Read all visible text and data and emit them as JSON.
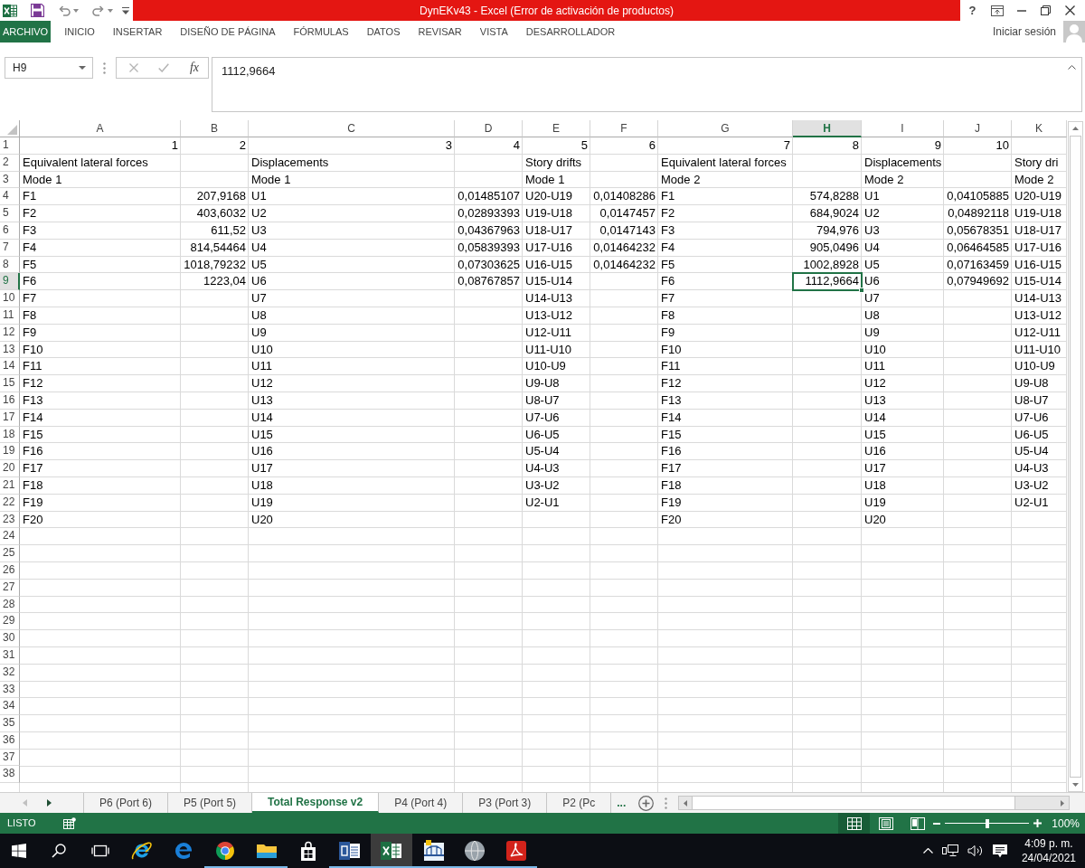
{
  "title_bar": {
    "title": "DynEKv43 - Excel (Error de activación de productos)",
    "help": "?"
  },
  "ribbon_tabs": [
    {
      "label": "ARCHIVO",
      "kind": "file",
      "selected": false
    },
    {
      "label": "INICIO",
      "kind": "tab",
      "selected": false
    },
    {
      "label": "INSERTAR",
      "kind": "tab",
      "selected": false
    },
    {
      "label": "DISEÑO DE PÁGINA",
      "kind": "tab",
      "selected": false
    },
    {
      "label": "FÓRMULAS",
      "kind": "tab",
      "selected": false
    },
    {
      "label": "DATOS",
      "kind": "tab",
      "selected": false
    },
    {
      "label": "REVISAR",
      "kind": "tab",
      "selected": false
    },
    {
      "label": "VISTA",
      "kind": "tab",
      "selected": false
    },
    {
      "label": "DESARROLLADOR",
      "kind": "tab",
      "selected": false
    }
  ],
  "account": {
    "label": "Iniciar sesión"
  },
  "formula_bar": {
    "name_box": "H9",
    "editing": false,
    "insert_function": "fx",
    "value": "1112,9664"
  },
  "columns": [
    {
      "label": "A",
      "selected": false
    },
    {
      "label": "B",
      "selected": false
    },
    {
      "label": "C",
      "selected": false
    },
    {
      "label": "D",
      "selected": false
    },
    {
      "label": "E",
      "selected": false
    },
    {
      "label": "F",
      "selected": false
    },
    {
      "label": "G",
      "selected": false
    },
    {
      "label": "H",
      "selected": true
    },
    {
      "label": "I",
      "selected": false
    },
    {
      "label": "J",
      "selected": false
    },
    {
      "label": "K",
      "selected": false
    }
  ],
  "rows": [
    {
      "label": "1",
      "selected": false,
      "cells": [
        {
          "kind": "number",
          "text": "1"
        },
        {
          "kind": "number",
          "text": "2"
        },
        {
          "kind": "number",
          "text": "3"
        },
        {
          "kind": "number",
          "text": "4"
        },
        {
          "kind": "number",
          "text": "5"
        },
        {
          "kind": "number",
          "text": "6"
        },
        {
          "kind": "number",
          "text": "7"
        },
        {
          "kind": "number",
          "text": "8"
        },
        {
          "kind": "number",
          "text": "9"
        },
        {
          "kind": "number",
          "text": "10"
        }
      ]
    },
    {
      "label": "2",
      "selected": false,
      "cells": [
        {
          "kind": "text",
          "text": "Equivalent lateral forces"
        },
        {
          "kind": "blank"
        },
        {
          "kind": "text",
          "text": "Displacements"
        },
        {
          "kind": "blank"
        },
        {
          "kind": "text",
          "text": "Story drifts"
        },
        {
          "kind": "blank"
        },
        {
          "kind": "text",
          "text": "Equivalent lateral forces"
        },
        {
          "kind": "blank"
        },
        {
          "kind": "text",
          "text": "Displacements"
        },
        {
          "kind": "blank"
        },
        {
          "kind": "text",
          "text": "Story dri"
        }
      ]
    },
    {
      "label": "3",
      "selected": false,
      "cells": [
        {
          "kind": "text",
          "text": "Mode 1"
        },
        {
          "kind": "blank"
        },
        {
          "kind": "text",
          "text": "Mode 1"
        },
        {
          "kind": "blank"
        },
        {
          "kind": "text",
          "text": "Mode 1"
        },
        {
          "kind": "blank"
        },
        {
          "kind": "text",
          "text": "Mode 2"
        },
        {
          "kind": "blank"
        },
        {
          "kind": "text",
          "text": "Mode 2"
        },
        {
          "kind": "blank"
        },
        {
          "kind": "text",
          "text": "Mode 2"
        }
      ]
    },
    {
      "label": "4",
      "selected": false,
      "cells": [
        {
          "kind": "text",
          "text": "F1"
        },
        {
          "kind": "number",
          "text": "207,9168"
        },
        {
          "kind": "text",
          "text": "U1"
        },
        {
          "kind": "number",
          "text": "0,01485107"
        },
        {
          "kind": "text",
          "text": "U20-U19"
        },
        {
          "kind": "number",
          "text": "0,01408286"
        },
        {
          "kind": "text",
          "text": "F1"
        },
        {
          "kind": "number",
          "text": "574,8288"
        },
        {
          "kind": "text",
          "text": "U1"
        },
        {
          "kind": "number",
          "text": "0,04105885"
        },
        {
          "kind": "text",
          "text": "U20-U19"
        }
      ]
    },
    {
      "label": "5",
      "selected": false,
      "cells": [
        {
          "kind": "text",
          "text": "F2"
        },
        {
          "kind": "number",
          "text": "403,6032"
        },
        {
          "kind": "text",
          "text": "U2"
        },
        {
          "kind": "number",
          "text": "0,02893393"
        },
        {
          "kind": "text",
          "text": "U19-U18"
        },
        {
          "kind": "number",
          "text": "0,0147457"
        },
        {
          "kind": "text",
          "text": "F2"
        },
        {
          "kind": "number",
          "text": "684,9024"
        },
        {
          "kind": "text",
          "text": "U2"
        },
        {
          "kind": "number",
          "text": "0,04892118"
        },
        {
          "kind": "text",
          "text": "U19-U18"
        }
      ]
    },
    {
      "label": "6",
      "selected": false,
      "cells": [
        {
          "kind": "text",
          "text": "F3"
        },
        {
          "kind": "number",
          "text": "611,52"
        },
        {
          "kind": "text",
          "text": "U3"
        },
        {
          "kind": "number",
          "text": "0,04367963"
        },
        {
          "kind": "text",
          "text": "U18-U17"
        },
        {
          "kind": "number",
          "text": "0,0147143"
        },
        {
          "kind": "text",
          "text": "F3"
        },
        {
          "kind": "number",
          "text": "794,976"
        },
        {
          "kind": "text",
          "text": "U3"
        },
        {
          "kind": "number",
          "text": "0,05678351"
        },
        {
          "kind": "text",
          "text": "U18-U17"
        }
      ]
    },
    {
      "label": "7",
      "selected": false,
      "cells": [
        {
          "kind": "text",
          "text": "F4"
        },
        {
          "kind": "number",
          "text": "814,54464"
        },
        {
          "kind": "text",
          "text": "U4"
        },
        {
          "kind": "number",
          "text": "0,05839393"
        },
        {
          "kind": "text",
          "text": "U17-U16"
        },
        {
          "kind": "number",
          "text": "0,01464232"
        },
        {
          "kind": "text",
          "text": "F4"
        },
        {
          "kind": "number",
          "text": "905,0496"
        },
        {
          "kind": "text",
          "text": "U4"
        },
        {
          "kind": "number",
          "text": "0,06464585"
        },
        {
          "kind": "text",
          "text": "U17-U16"
        }
      ]
    },
    {
      "label": "8",
      "selected": false,
      "cells": [
        {
          "kind": "text",
          "text": "F5"
        },
        {
          "kind": "number",
          "text": "1018,79232"
        },
        {
          "kind": "text",
          "text": "U5"
        },
        {
          "kind": "number",
          "text": "0,07303625"
        },
        {
          "kind": "text",
          "text": "U16-U15"
        },
        {
          "kind": "number",
          "text": "0,01464232"
        },
        {
          "kind": "text",
          "text": "F5"
        },
        {
          "kind": "number",
          "text": "1002,8928"
        },
        {
          "kind": "text",
          "text": "U5"
        },
        {
          "kind": "number",
          "text": "0,07163459"
        },
        {
          "kind": "text",
          "text": "U16-U15"
        }
      ]
    },
    {
      "label": "9",
      "selected": true,
      "cells": [
        {
          "kind": "text",
          "text": "F6"
        },
        {
          "kind": "number",
          "text": "1223,04"
        },
        {
          "kind": "text",
          "text": "U6"
        },
        {
          "kind": "number",
          "text": "0,08767857"
        },
        {
          "kind": "text",
          "text": "U15-U14"
        },
        {
          "kind": "blank"
        },
        {
          "kind": "text",
          "text": "F6"
        },
        {
          "kind": "number",
          "text": "1112,9664"
        },
        {
          "kind": "text",
          "text": "U6"
        },
        {
          "kind": "number",
          "text": "0,07949692"
        },
        {
          "kind": "text",
          "text": "U15-U14"
        }
      ]
    },
    {
      "label": "10",
      "selected": false,
      "cells": [
        {
          "kind": "text",
          "text": "F7"
        },
        {
          "kind": "blank"
        },
        {
          "kind": "text",
          "text": "U7"
        },
        {
          "kind": "blank"
        },
        {
          "kind": "text",
          "text": "U14-U13"
        },
        {
          "kind": "blank"
        },
        {
          "kind": "text",
          "text": "F7"
        },
        {
          "kind": "blank"
        },
        {
          "kind": "text",
          "text": "U7"
        },
        {
          "kind": "blank"
        },
        {
          "kind": "text",
          "text": "U14-U13"
        }
      ]
    },
    {
      "label": "11",
      "selected": false,
      "cells": [
        {
          "kind": "text",
          "text": "F8"
        },
        {
          "kind": "blank"
        },
        {
          "kind": "text",
          "text": "U8"
        },
        {
          "kind": "blank"
        },
        {
          "kind": "text",
          "text": "U13-U12"
        },
        {
          "kind": "blank"
        },
        {
          "kind": "text",
          "text": "F8"
        },
        {
          "kind": "blank"
        },
        {
          "kind": "text",
          "text": "U8"
        },
        {
          "kind": "blank"
        },
        {
          "kind": "text",
          "text": "U13-U12"
        }
      ]
    },
    {
      "label": "12",
      "selected": false,
      "cells": [
        {
          "kind": "text",
          "text": "F9"
        },
        {
          "kind": "blank"
        },
        {
          "kind": "text",
          "text": "U9"
        },
        {
          "kind": "blank"
        },
        {
          "kind": "text",
          "text": "U12-U11"
        },
        {
          "kind": "blank"
        },
        {
          "kind": "text",
          "text": "F9"
        },
        {
          "kind": "blank"
        },
        {
          "kind": "text",
          "text": "U9"
        },
        {
          "kind": "blank"
        },
        {
          "kind": "text",
          "text": "U12-U11"
        }
      ]
    },
    {
      "label": "13",
      "selected": false,
      "cells": [
        {
          "kind": "text",
          "text": "F10"
        },
        {
          "kind": "blank"
        },
        {
          "kind": "text",
          "text": "U10"
        },
        {
          "kind": "blank"
        },
        {
          "kind": "text",
          "text": "U11-U10"
        },
        {
          "kind": "blank"
        },
        {
          "kind": "text",
          "text": "F10"
        },
        {
          "kind": "blank"
        },
        {
          "kind": "text",
          "text": "U10"
        },
        {
          "kind": "blank"
        },
        {
          "kind": "text",
          "text": "U11-U10"
        }
      ]
    },
    {
      "label": "14",
      "selected": false,
      "cells": [
        {
          "kind": "text",
          "text": "F11"
        },
        {
          "kind": "blank"
        },
        {
          "kind": "text",
          "text": "U11"
        },
        {
          "kind": "blank"
        },
        {
          "kind": "text",
          "text": "U10-U9"
        },
        {
          "kind": "blank"
        },
        {
          "kind": "text",
          "text": "F11"
        },
        {
          "kind": "blank"
        },
        {
          "kind": "text",
          "text": "U11"
        },
        {
          "kind": "blank"
        },
        {
          "kind": "text",
          "text": "U10-U9"
        }
      ]
    },
    {
      "label": "15",
      "selected": false,
      "cells": [
        {
          "kind": "text",
          "text": "F12"
        },
        {
          "kind": "blank"
        },
        {
          "kind": "text",
          "text": "U12"
        },
        {
          "kind": "blank"
        },
        {
          "kind": "text",
          "text": "U9-U8"
        },
        {
          "kind": "blank"
        },
        {
          "kind": "text",
          "text": "F12"
        },
        {
          "kind": "blank"
        },
        {
          "kind": "text",
          "text": "U12"
        },
        {
          "kind": "blank"
        },
        {
          "kind": "text",
          "text": "U9-U8"
        }
      ]
    },
    {
      "label": "16",
      "selected": false,
      "cells": [
        {
          "kind": "text",
          "text": "F13"
        },
        {
          "kind": "blank"
        },
        {
          "kind": "text",
          "text": "U13"
        },
        {
          "kind": "blank"
        },
        {
          "kind": "text",
          "text": "U8-U7"
        },
        {
          "kind": "blank"
        },
        {
          "kind": "text",
          "text": "F13"
        },
        {
          "kind": "blank"
        },
        {
          "kind": "text",
          "text": "U13"
        },
        {
          "kind": "blank"
        },
        {
          "kind": "text",
          "text": "U8-U7"
        }
      ]
    },
    {
      "label": "17",
      "selected": false,
      "cells": [
        {
          "kind": "text",
          "text": "F14"
        },
        {
          "kind": "blank"
        },
        {
          "kind": "text",
          "text": "U14"
        },
        {
          "kind": "blank"
        },
        {
          "kind": "text",
          "text": "U7-U6"
        },
        {
          "kind": "blank"
        },
        {
          "kind": "text",
          "text": "F14"
        },
        {
          "kind": "blank"
        },
        {
          "kind": "text",
          "text": "U14"
        },
        {
          "kind": "blank"
        },
        {
          "kind": "text",
          "text": "U7-U6"
        }
      ]
    },
    {
      "label": "18",
      "selected": false,
      "cells": [
        {
          "kind": "text",
          "text": "F15"
        },
        {
          "kind": "blank"
        },
        {
          "kind": "text",
          "text": "U15"
        },
        {
          "kind": "blank"
        },
        {
          "kind": "text",
          "text": "U6-U5"
        },
        {
          "kind": "blank"
        },
        {
          "kind": "text",
          "text": "F15"
        },
        {
          "kind": "blank"
        },
        {
          "kind": "text",
          "text": "U15"
        },
        {
          "kind": "blank"
        },
        {
          "kind": "text",
          "text": "U6-U5"
        }
      ]
    },
    {
      "label": "19",
      "selected": false,
      "cells": [
        {
          "kind": "text",
          "text": "F16"
        },
        {
          "kind": "blank"
        },
        {
          "kind": "text",
          "text": "U16"
        },
        {
          "kind": "blank"
        },
        {
          "kind": "text",
          "text": "U5-U4"
        },
        {
          "kind": "blank"
        },
        {
          "kind": "text",
          "text": "F16"
        },
        {
          "kind": "blank"
        },
        {
          "kind": "text",
          "text": "U16"
        },
        {
          "kind": "blank"
        },
        {
          "kind": "text",
          "text": "U5-U4"
        }
      ]
    },
    {
      "label": "20",
      "selected": false,
      "cells": [
        {
          "kind": "text",
          "text": "F17"
        },
        {
          "kind": "blank"
        },
        {
          "kind": "text",
          "text": "U17"
        },
        {
          "kind": "blank"
        },
        {
          "kind": "text",
          "text": "U4-U3"
        },
        {
          "kind": "blank"
        },
        {
          "kind": "text",
          "text": "F17"
        },
        {
          "kind": "blank"
        },
        {
          "kind": "text",
          "text": "U17"
        },
        {
          "kind": "blank"
        },
        {
          "kind": "text",
          "text": "U4-U3"
        }
      ]
    },
    {
      "label": "21",
      "selected": false,
      "cells": [
        {
          "kind": "text",
          "text": "F18"
        },
        {
          "kind": "blank"
        },
        {
          "kind": "text",
          "text": "U18"
        },
        {
          "kind": "blank"
        },
        {
          "kind": "text",
          "text": "U3-U2"
        },
        {
          "kind": "blank"
        },
        {
          "kind": "text",
          "text": "F18"
        },
        {
          "kind": "blank"
        },
        {
          "kind": "text",
          "text": "U18"
        },
        {
          "kind": "blank"
        },
        {
          "kind": "text",
          "text": "U3-U2"
        }
      ]
    },
    {
      "label": "22",
      "selected": false,
      "cells": [
        {
          "kind": "text",
          "text": "F19"
        },
        {
          "kind": "blank"
        },
        {
          "kind": "text",
          "text": "U19"
        },
        {
          "kind": "blank"
        },
        {
          "kind": "text",
          "text": "U2-U1"
        },
        {
          "kind": "blank"
        },
        {
          "kind": "text",
          "text": "F19"
        },
        {
          "kind": "blank"
        },
        {
          "kind": "text",
          "text": "U19"
        },
        {
          "kind": "blank"
        },
        {
          "kind": "text",
          "text": "U2-U1"
        }
      ]
    },
    {
      "label": "23",
      "selected": false,
      "cells": [
        {
          "kind": "text",
          "text": "F20"
        },
        {
          "kind": "blank"
        },
        {
          "kind": "text",
          "text": "U20"
        },
        {
          "kind": "blank"
        },
        {
          "kind": "blank"
        },
        {
          "kind": "blank"
        },
        {
          "kind": "text",
          "text": "F20"
        },
        {
          "kind": "blank"
        },
        {
          "kind": "text",
          "text": "U20"
        }
      ]
    },
    {
      "label": "24",
      "selected": false
    },
    {
      "label": "25",
      "selected": false
    },
    {
      "label": "26",
      "selected": false
    },
    {
      "label": "27",
      "selected": false
    },
    {
      "label": "28",
      "selected": false
    },
    {
      "label": "29",
      "selected": false
    },
    {
      "label": "30",
      "selected": false
    },
    {
      "label": "31",
      "selected": false
    },
    {
      "label": "32",
      "selected": false
    },
    {
      "label": "33",
      "selected": false
    },
    {
      "label": "34",
      "selected": false
    },
    {
      "label": "35",
      "selected": false
    },
    {
      "label": "36",
      "selected": false
    },
    {
      "label": "37",
      "selected": false
    },
    {
      "label": "38",
      "selected": false
    }
  ],
  "sheet_tabs": [
    {
      "label": "P6 (Port 6)",
      "selected": false
    },
    {
      "label": "P5 (Port 5)",
      "selected": false
    },
    {
      "label": "Total Response v2",
      "selected": true
    },
    {
      "label": "P4 (Port 4)",
      "selected": false
    },
    {
      "label": "P3 (Port 3)",
      "selected": false
    },
    {
      "label": "P2 (Pc",
      "selected": false
    }
  ],
  "more_tabs": "...",
  "status_bar": {
    "status": "LISTO",
    "views": [
      {
        "kind": "normal",
        "selected": true
      },
      {
        "kind": "layout",
        "selected": false
      },
      {
        "kind": "pagebreak",
        "selected": false
      }
    ],
    "zoom": {
      "level": 0.5,
      "reading": "100%"
    }
  },
  "taskbar": {
    "items": [
      {
        "kind": "start",
        "selected": false,
        "running": false
      },
      {
        "kind": "search",
        "selected": false,
        "running": false
      },
      {
        "kind": "taskview",
        "selected": false,
        "running": false
      },
      {
        "kind": "iebrowser",
        "selected": false,
        "running": false
      },
      {
        "kind": "edgebrowser",
        "selected": false,
        "running": false
      },
      {
        "kind": "chrome",
        "selected": false,
        "running": true
      },
      {
        "kind": "explorer",
        "selected": false,
        "running": true
      },
      {
        "kind": "store",
        "selected": false,
        "running": false
      },
      {
        "kind": "word",
        "selected": false,
        "running": true
      },
      {
        "kind": "excel",
        "selected": true,
        "running": true
      },
      {
        "kind": "bridge",
        "selected": false,
        "running": true
      },
      {
        "kind": "globe",
        "selected": false,
        "running": true
      },
      {
        "kind": "acrobat",
        "selected": false,
        "running": true
      }
    ],
    "time": "4:09 p. m.",
    "date": "24/04/2021"
  }
}
